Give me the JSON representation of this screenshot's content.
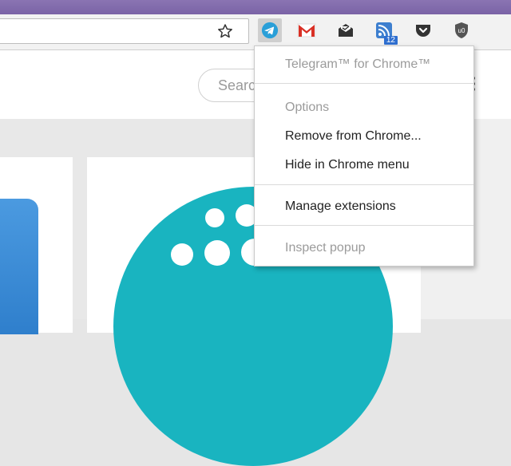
{
  "toolbar": {
    "bookmark_icon": "star-icon",
    "extensions": [
      {
        "name": "telegram-extension",
        "icon": "telegram-icon",
        "active": true
      },
      {
        "name": "gmail-extension",
        "icon": "gmail-icon"
      },
      {
        "name": "mail-extension",
        "icon": "envelope-icon"
      },
      {
        "name": "feed-extension",
        "icon": "rss-icon",
        "badge": "12"
      },
      {
        "name": "pocket-extension",
        "icon": "pocket-icon"
      },
      {
        "name": "ublock-extension",
        "icon": "shield-icon"
      }
    ]
  },
  "page": {
    "search_text": "Searc",
    "accent_color": "#19b4c0"
  },
  "context_menu": {
    "title": "Telegram™ for Chrome™",
    "options": "Options",
    "remove": "Remove from Chrome...",
    "hide": "Hide in Chrome menu",
    "manage": "Manage extensions",
    "inspect": "Inspect popup"
  }
}
